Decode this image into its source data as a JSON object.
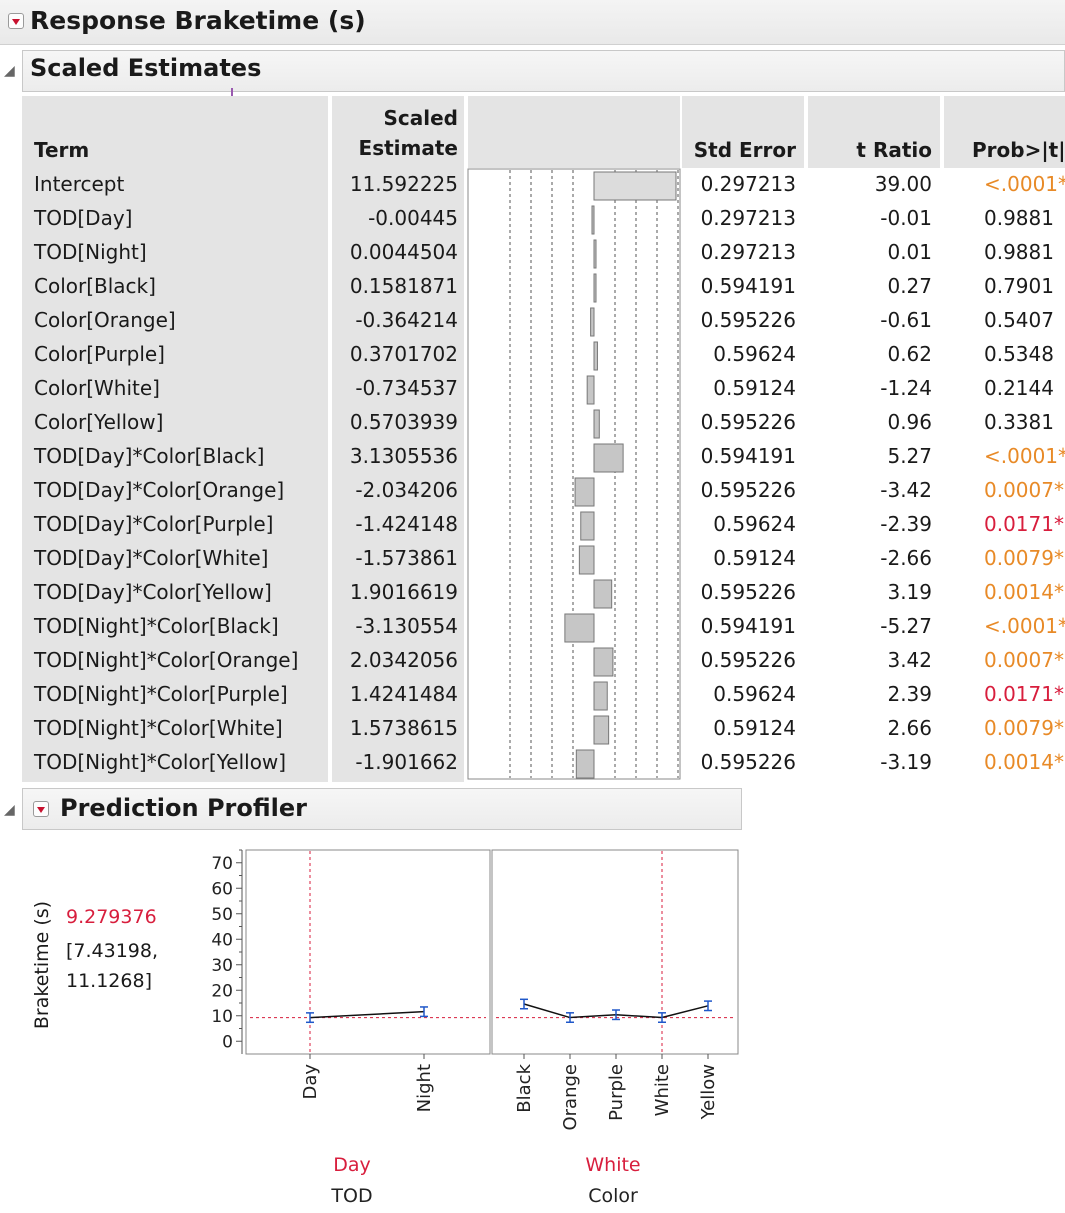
{
  "response_title": "Response Braketime (s)",
  "scaled_estimates": {
    "title": "Scaled Estimates",
    "headers": {
      "term": "Term",
      "scaled_top": "Scaled",
      "scaled_bottom": "Estimate",
      "std_error": "Std Error",
      "t_ratio": "t Ratio",
      "prob": "Prob>|t|"
    },
    "rows": [
      {
        "term": "Intercept",
        "estimate": "11.592225",
        "stderr": "0.297213",
        "t": "39.00",
        "p": "<.0001*",
        "p_color": "#e88a27",
        "bar": 11.592225
      },
      {
        "term": "TOD[Day]",
        "estimate": "-0.00445",
        "stderr": "0.297213",
        "t": "-0.01",
        "p": "0.9881",
        "p_color": "#1a1a1a",
        "bar": -0.00445
      },
      {
        "term": "TOD[Night]",
        "estimate": "0.0044504",
        "stderr": "0.297213",
        "t": "0.01",
        "p": "0.9881",
        "p_color": "#1a1a1a",
        "bar": 0.0044504
      },
      {
        "term": "Color[Black]",
        "estimate": "0.1581871",
        "stderr": "0.594191",
        "t": "0.27",
        "p": "0.7901",
        "p_color": "#1a1a1a",
        "bar": 0.1581871
      },
      {
        "term": "Color[Orange]",
        "estimate": "-0.364214",
        "stderr": "0.595226",
        "t": "-0.61",
        "p": "0.5407",
        "p_color": "#1a1a1a",
        "bar": -0.364214
      },
      {
        "term": "Color[Purple]",
        "estimate": "0.3701702",
        "stderr": "0.59624",
        "t": "0.62",
        "p": "0.5348",
        "p_color": "#1a1a1a",
        "bar": 0.3701702
      },
      {
        "term": "Color[White]",
        "estimate": "-0.734537",
        "stderr": "0.59124",
        "t": "-1.24",
        "p": "0.2144",
        "p_color": "#1a1a1a",
        "bar": -0.734537
      },
      {
        "term": "Color[Yellow]",
        "estimate": "0.5703939",
        "stderr": "0.595226",
        "t": "0.96",
        "p": "0.3381",
        "p_color": "#1a1a1a",
        "bar": 0.5703939
      },
      {
        "term": "TOD[Day]*Color[Black]",
        "estimate": "3.1305536",
        "stderr": "0.594191",
        "t": "5.27",
        "p": "<.0001*",
        "p_color": "#e88a27",
        "bar": 3.1305536
      },
      {
        "term": "TOD[Day]*Color[Orange]",
        "estimate": "-2.034206",
        "stderr": "0.595226",
        "t": "-3.42",
        "p": "0.0007*",
        "p_color": "#e88a27",
        "bar": -2.034206
      },
      {
        "term": "TOD[Day]*Color[Purple]",
        "estimate": "-1.424148",
        "stderr": "0.59624",
        "t": "-2.39",
        "p": "0.0171*",
        "p_color": "#d81e3d",
        "bar": -1.424148
      },
      {
        "term": "TOD[Day]*Color[White]",
        "estimate": "-1.573861",
        "stderr": "0.59124",
        "t": "-2.66",
        "p": "0.0079*",
        "p_color": "#e88a27",
        "bar": -1.573861
      },
      {
        "term": "TOD[Day]*Color[Yellow]",
        "estimate": "1.9016619",
        "stderr": "0.595226",
        "t": "3.19",
        "p": "0.0014*",
        "p_color": "#e88a27",
        "bar": 1.9016619
      },
      {
        "term": "TOD[Night]*Color[Black]",
        "estimate": "-3.130554",
        "stderr": "0.594191",
        "t": "-5.27",
        "p": "<.0001*",
        "p_color": "#e88a27",
        "bar": -3.130554
      },
      {
        "term": "TOD[Night]*Color[Orange]",
        "estimate": "2.0342056",
        "stderr": "0.595226",
        "t": "3.42",
        "p": "0.0007*",
        "p_color": "#e88a27",
        "bar": 2.0342056
      },
      {
        "term": "TOD[Night]*Color[Purple]",
        "estimate": "1.4241484",
        "stderr": "0.59624",
        "t": "2.39",
        "p": "0.0171*",
        "p_color": "#d81e3d",
        "bar": 1.4241484
      },
      {
        "term": "TOD[Night]*Color[White]",
        "estimate": "1.5738615",
        "stderr": "0.59124",
        "t": "2.66",
        "p": "0.0079*",
        "p_color": "#e88a27",
        "bar": 1.5738615
      },
      {
        "term": "TOD[Night]*Color[Yellow]",
        "estimate": "-1.901662",
        "stderr": "0.595226",
        "t": "-3.19",
        "p": "0.0014*",
        "p_color": "#e88a27",
        "bar": -1.901662
      }
    ]
  },
  "profiler": {
    "title": "Prediction Profiler",
    "ylabel": "Braketime (s)",
    "current_value": "9.279376",
    "ci_low": "[7.43198,",
    "ci_high": "11.1268]",
    "yticks": [
      "70",
      "60",
      "50",
      "40",
      "30",
      "20",
      "10",
      "0"
    ],
    "yrange": [
      -5,
      75
    ],
    "hline_value": 9.279376,
    "panels": [
      {
        "factor": "TOD",
        "current_level": "Day",
        "levels": [
          "Day",
          "Night"
        ],
        "means": [
          9.28,
          11.6
        ],
        "err": [
          1.85,
          1.85
        ]
      },
      {
        "factor": "Color",
        "current_level": "White",
        "levels": [
          "Black",
          "Orange",
          "Purple",
          "White",
          "Yellow"
        ],
        "means": [
          14.6,
          9.3,
          10.4,
          9.3,
          13.9
        ],
        "err": [
          1.85,
          1.85,
          1.85,
          1.85,
          1.85
        ]
      }
    ]
  },
  "colors": {
    "red_accent": "#d81e3d",
    "orange_sig": "#e88a27",
    "bar_fill": "#c6c6c6",
    "ci_blue": "#1f57c9"
  }
}
